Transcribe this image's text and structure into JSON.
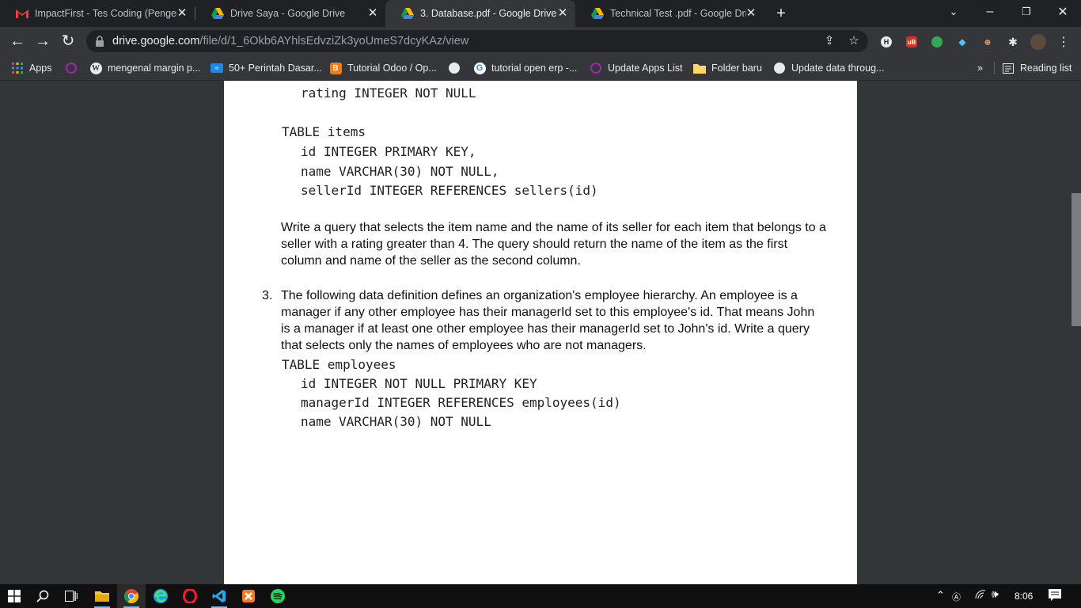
{
  "tabs": [
    {
      "title": "ImpactFirst - Tes Coding (Pengem",
      "icon": "gmail-icon"
    },
    {
      "title": "Drive Saya - Google Drive",
      "icon": "google-drive-icon"
    },
    {
      "title": "3. Database.pdf - Google Drive",
      "icon": "google-drive-icon"
    },
    {
      "title": "Technical Test .pdf - Google Drive",
      "icon": "google-drive-icon"
    }
  ],
  "address": {
    "host": "drive.google.com",
    "path": "/file/d/1_6Okb6AYhlsEdvziZk3yoUmeS7dcyKAz/view"
  },
  "bookmarks": {
    "items": [
      {
        "label": "Apps"
      },
      {
        "label": ""
      },
      {
        "label": "mengenal margin p..."
      },
      {
        "label": "50+ Perintah Dasar..."
      },
      {
        "label": "Tutorial Odoo / Op..."
      },
      {
        "label": ""
      },
      {
        "label": "tutorial open erp -..."
      },
      {
        "label": "Update Apps List"
      },
      {
        "label": "Folder baru"
      },
      {
        "label": "Update data throug..."
      }
    ],
    "more": "»",
    "reading_list": "Reading list"
  },
  "doc": {
    "rating_line": "rating INTEGER NOT NULL",
    "items_table": "TABLE items",
    "items_cols": [
      "id INTEGER PRIMARY KEY,",
      "name VARCHAR(30) NOT NULL,",
      "sellerId INTEGER REFERENCES sellers(id)"
    ],
    "q2_text": "Write a query that selects the item name and the name of its seller for each item that belongs to a seller with a rating greater than 4. The query should return the name of the item as the first column and name of the seller as the second column.",
    "q3_number": "3.",
    "q3_text": "The following data definition defines an organization's employee hierarchy. An employee is a manager if any other employee has their managerId set to this employee's id. That means John is a manager if at least one other employee has their managerId set to John's id. Write a query that selects only the names of employees who are not managers.",
    "emp_table": "TABLE employees",
    "emp_cols": [
      "id INTEGER NOT NULL PRIMARY KEY",
      "managerId INTEGER REFERENCES employees(id)",
      "name VARCHAR(30) NOT NULL"
    ]
  },
  "taskbar": {
    "clock": "8:06",
    "tray_label": "Ⓐ"
  },
  "colors": {
    "tabbar_bg": "#202124",
    "toolbar_bg": "#35363a",
    "viewer_bg": "#323639",
    "page_bg": "#ffffff"
  }
}
